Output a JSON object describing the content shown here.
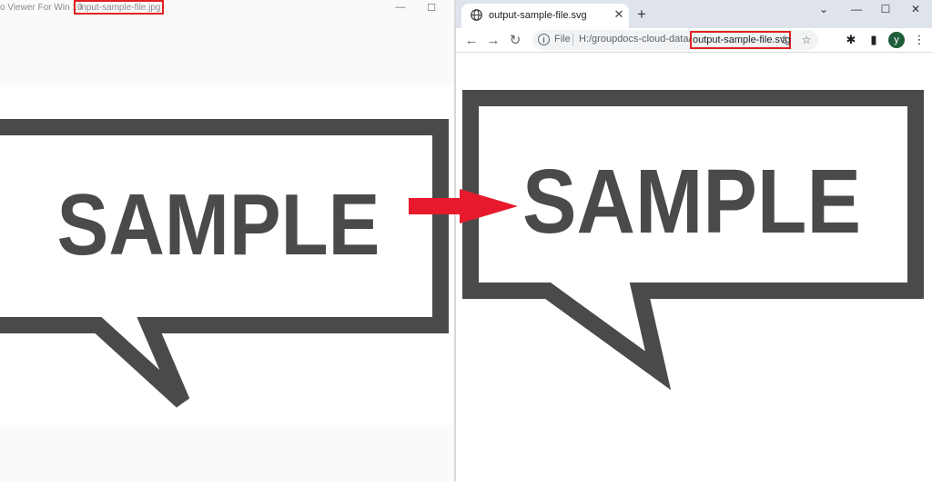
{
  "viewer": {
    "title": "o Viewer For Win 10",
    "filename": "input-sample-file.jpg",
    "image_text": "SAMPLE",
    "window_buttons": {
      "minimize": "—",
      "maximize": "☐"
    }
  },
  "browser": {
    "tab_title": "output-sample-file.svg",
    "tab_close": "✕",
    "new_tab": "+",
    "window_buttons": {
      "menu": "⌄",
      "minimize": "—",
      "maximize": "☐",
      "close": "✕"
    },
    "nav": {
      "back": "←",
      "forward": "→",
      "reload": "↻"
    },
    "url": {
      "scheme_label": "File",
      "prefix": "H:/groupdocs-cloud-data/",
      "filename": "output-sample-file.svg",
      "info": "i"
    },
    "toolbar_icons": {
      "share": "⇪",
      "star": "☆",
      "extensions": "✱",
      "sidepanel": "▮",
      "menu": "⋮"
    },
    "profile_initial": "y",
    "image_text": "SAMPLE"
  },
  "colors": {
    "frame": "#4a4a4a",
    "highlight": "#e02020",
    "arrow": "#e8192c",
    "avatar": "#1e5e3a"
  },
  "icons": [
    "globe-icon",
    "info-icon",
    "share-icon",
    "star-icon",
    "puzzle-icon",
    "sidepanel-icon",
    "kebab-menu-icon",
    "arrow-right-icon"
  ]
}
